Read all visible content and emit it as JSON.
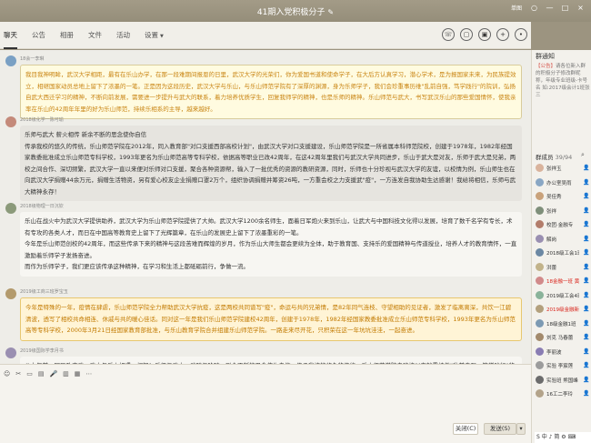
{
  "window": {
    "title": "41期入党积极分子",
    "user": "单图",
    "controls": [
      "○",
      "—",
      "□",
      "×"
    ]
  },
  "tabs": [
    "聊天",
    "公告",
    "相册",
    "文件",
    "活动",
    "设置"
  ],
  "tool_icons": [
    "☏",
    "▢",
    "▣",
    "+",
    "•"
  ],
  "messages": [
    {
      "sender": "18会一李琳",
      "style": "yellow",
      "text": "我目我神明眸，武汉大学相距，最有在乐山办学，在那一段难期间报恩的日里，武汉大学的光荣们，你为爱国书道和使命学子，在大后方认真学习，潜心学术，是为报国家未来，为民族提效立，相继国家动员总地上留下了浓墨的一笔。正是因为这段历史，武汉大学与乐山，与乐山师范学院有了深厚的渊源，身为乐师学子，我们会珍重事历维\"乱前自强，笃学践行\"的院训，弘扬自武大西迁学习的精神，不断向前发展，需要进一步提升与武大的联系，着力培养优质学生，回复我师学的精神，也是乐师的精神。乐山师范与武大，书写武汉乐山的那些爱国情怀，使我亲率在乐山的42周年年里的好为乐山师范，持续乐相系的主导，越来越好。"
    },
    {
      "sender": "2018级化学一陈可瑜",
      "style": "gray",
      "text": "乐师与武大 薪火相传 新余不断的思念使你自信\n传承我校的悠久的传统，乐山师范学院在2012年，同入教育部\"对口支援西部高校计划\"，由武汉大学对口支援建设，乐山师范学院是一所省属本科师范院校，创建于1978年，1982年经国家教委批准成立乐山师范专科学校，1993年更名为乐山师范高等专科学校，依据高等职业已改42周年，在这42周年里我们与武汉大学共同进步，乐山于武大是对友，乐师于武大是兄弟，两校之间合作、深切频繁，武汉大学一直以来便对乐师对口支援，聚合各种资源帮，输入了一批优秀的资源的教研资源，同时，乐师也十分珍视与武汉大学的友谊，以校情为例，乐山师生也在向武汉大学捐赠44余万元，捐赠生活物资，另有爱心校友企业捐赠口罩2万个，组织协调捐赠并筹资26吨，一方重会校之力支援武\"疫\"，一方连发自我协助生达感谢！我给将相信，乐师与武大精神永存！"
    },
    {
      "sender": "2018级物理一日沉钦",
      "style": "plain",
      "text": "乐山在战火中为武汉大学提供助养，武汉大学为乐山师范学院提供了大帅。武汉大学1200余名师生，面着日军炮火来到乐山，让武大与中国科技文化得以发展，培育了数千名学有专长，术有专攻的各类人才，而日在中国高等教育史上留下了光辉篇章，在乐山的发展史上留下了浓墨重彩的一笔。\n今年是乐山师范创校的42周年，而这些传承下来的精神与这段苦难而辉煌的岁月，作为乐山大师生都会更续为全体，助于教育国、支持乐的爱国精神与传道授业，培养人才的教育情怀，一直激励着乐师学子发扬奋进。\n而作为乐师学子，我们更应该传承这种精神，在学习和生活上都砥砺前行，争做一流。"
    },
    {
      "sender": "2019级工商三班罗宝玉",
      "style": "warn",
      "text": "今年是特殊的一年，疫情在肆虐，乐山师范学院全力帮助武汉大学抗疫，这是两校共同谱写\"疫\"，命运与共的兄弟情，是82年同气连枝、守望相助的见证者，激发了临离离深，共饮一江碧清波，透写了相校共命相连、休戚与共的暖心佳话。同对这一年是我们乐山师范学院建校42周年，创建于1978年，1982年经国家教委批准成立乐山师范专科学校，1993年更名为乐山师范高等专科学校，2000年3月21日经国家教育部批准，与乐山教育学院合并组建乐山师范学院。一路走来尽开花，只积荣在这一年坑坑洼洼，一起奋进。"
    },
    {
      "sender": "2019级国际学李月书",
      "style": "plain",
      "text": "八十年前，国民政府武，武大与乐山相遇，相知！乐师与武大，武随与哈随，剧会不断的思念使你自信，传承我校的悠久的传统，乐山师范学院自建校以来就秉持着\"乱前自强，笃学践行\"的信念，不断孕育"
    }
  ],
  "input": {
    "tools": [
      "☺",
      "✂",
      "▭",
      "▤",
      "🎤",
      "▥",
      "▦",
      "⋯"
    ],
    "close_label": "关闭(C)",
    "send_label": "发送(S)"
  },
  "sidebar": {
    "notice_title": "群通知",
    "notice_tag": "【公告】",
    "notice_text": "请各位新入群的积极分子修改群昵称，年级专业班级-卡号名 如:2017级会计1班张三",
    "members_label": "群成员",
    "members_count": "39/94",
    "search_icon": "⌕",
    "members": [
      {
        "name": "张祥玉",
        "color": "#d9b39c",
        "red": false,
        "icon": "👤"
      },
      {
        "name": "办公室吴雨",
        "color": "#8aa7c4",
        "red": false,
        "icon": "👤"
      },
      {
        "name": "吴佳秀",
        "color": "#c9a27b",
        "red": false,
        "icon": "👤"
      },
      {
        "name": "张祥",
        "color": "#7f8f7a",
        "red": false,
        "icon": "👤"
      },
      {
        "name": "校团·金融专",
        "color": "#b37d6b",
        "red": false,
        "icon": "👤"
      },
      {
        "name": "解岗",
        "color": "#9a8fb1",
        "red": false,
        "icon": "👤"
      },
      {
        "name": "2018级工会1班",
        "color": "#6c88a3",
        "red": false,
        "icon": "👤"
      },
      {
        "name": "洪蕾",
        "color": "#c2b38a",
        "red": false,
        "icon": "👤"
      },
      {
        "name": "18金融一班 黄琪琪",
        "color": "#d18a8a",
        "red": true,
        "icon": "👤"
      },
      {
        "name": "2019级工会4班",
        "color": "#8ab39a",
        "red": false,
        "icon": "👤"
      },
      {
        "name": "2019级金融新秀",
        "color": "#b3a07d",
        "red": true,
        "icon": "👤"
      },
      {
        "name": "18级金融1班",
        "color": "#7d9ab3",
        "red": false,
        "icon": "👤"
      },
      {
        "name": "刘克 马春蕾",
        "color": "#a38a6c",
        "red": false,
        "icon": "👤"
      },
      {
        "name": "李丽波",
        "color": "#8a7db3",
        "red": false,
        "icon": "👤"
      },
      {
        "name": "实验 李宸莲",
        "color": "#9c9c9c",
        "red": false,
        "icon": "👤"
      },
      {
        "name": "实验班 熊国峰",
        "color": "#6c6c6c",
        "red": false,
        "icon": "👤"
      },
      {
        "name": "16工二李玲",
        "color": "#b3a38a",
        "red": false,
        "icon": "👤"
      }
    ]
  },
  "ime": "S 中 ♪ 简 ⚙ ⌨"
}
